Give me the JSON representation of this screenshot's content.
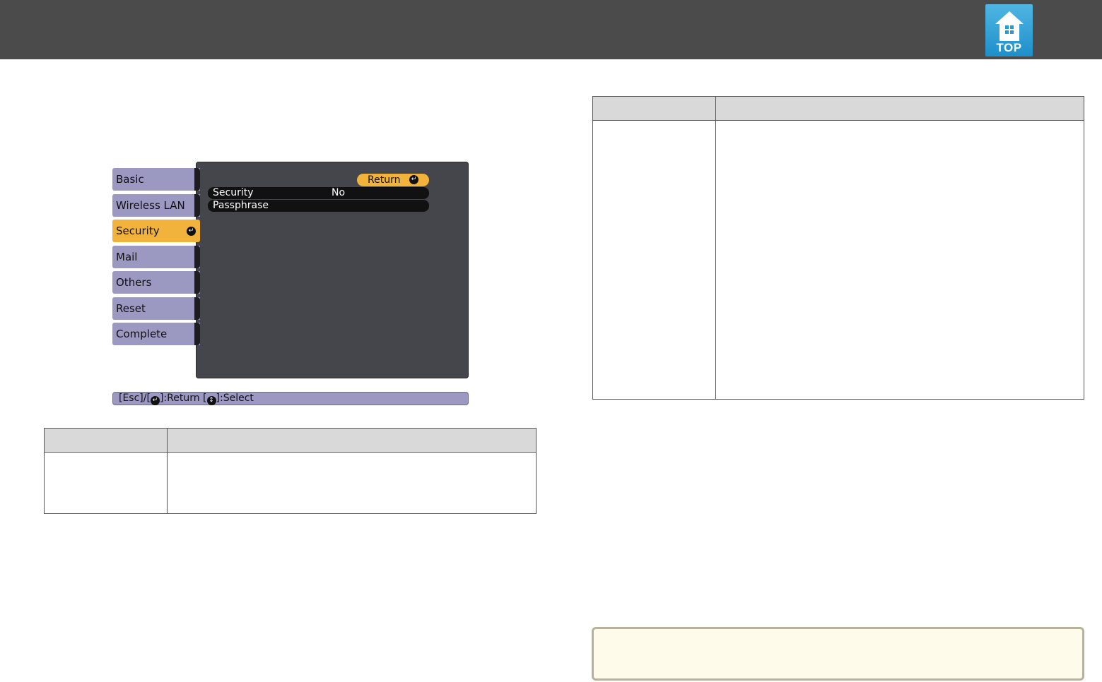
{
  "header": {
    "top_button_label": "TOP"
  },
  "projector_menu": {
    "sidebar": {
      "items": [
        {
          "label": "Basic"
        },
        {
          "label": "Wireless LAN"
        },
        {
          "label": "Security"
        },
        {
          "label": "Mail"
        },
        {
          "label": "Others"
        },
        {
          "label": "Reset"
        },
        {
          "label": "Complete"
        }
      ]
    },
    "return_label": "Return",
    "rows": [
      {
        "label": "Security",
        "value": "No"
      },
      {
        "label": "Passphrase",
        "value": ""
      }
    ],
    "hint": {
      "esc_part": "[Esc]/[",
      "return_part": "]:Return  [",
      "select_part": "]:Select"
    }
  },
  "colors": {
    "header_bar": "#4b4b4b",
    "menu_tab": "#9b98c2",
    "menu_active": "#f2b33c",
    "menu_panel": "#45464c",
    "top_icon": "#2a9ad4",
    "table_header": "#d9d9d9",
    "note_background": "#fffbea"
  },
  "icons": [
    "home-icon",
    "enter-icon",
    "up-down-icon"
  ]
}
